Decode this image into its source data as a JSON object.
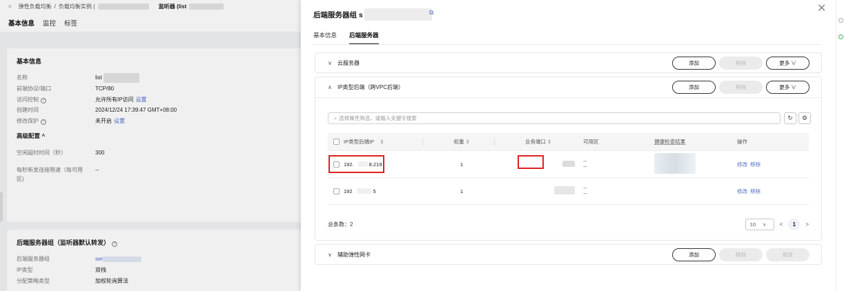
{
  "bg": {
    "breadcrumb": [
      "弹性负载均衡",
      "负载均衡实例 (",
      "监听器 (list"
    ],
    "tabs": [
      "基本信息",
      "监控",
      "标签"
    ],
    "card1": {
      "title": "基本信息",
      "rows": [
        {
          "k": "名称",
          "v": "list"
        },
        {
          "k": "前端协议/端口",
          "v": "TCP/80"
        },
        {
          "k": "访问控制",
          "v": "允许所有IP访问",
          "link": "设置"
        },
        {
          "k": "创建时间",
          "v": "2024/12/24 17:39:47 GMT+08:00"
        },
        {
          "k": "修改保护",
          "v": "未开启",
          "link": "设置"
        }
      ],
      "advanced": "高级配置 ^",
      "rows2": [
        {
          "k": "空闲超时时间（秒）",
          "v": "300"
        },
        {
          "k": "每秒新发连接限速（每可用",
          "v": "--"
        },
        {
          "k": "区)",
          "v": ""
        }
      ]
    },
    "card2": {
      "title": "后端服务器组（监听器默认转发）",
      "rows": [
        {
          "k": "后端服务器组",
          "v": "ser"
        },
        {
          "k": "IP类型",
          "v": "双栈"
        },
        {
          "k": "分配策略类型",
          "v": "加权轮询算法"
        }
      ]
    }
  },
  "drawer": {
    "title": "后端服务器组 s",
    "tabs": [
      "基本信息",
      "后端服务器"
    ],
    "sections": [
      {
        "title": "云服务器",
        "chev": "∨",
        "buttons": {
          "add": "添加",
          "remove": "移除",
          "more": "更多 ∨"
        }
      },
      {
        "title": "IP类型后端（跨VPC后端）",
        "chev": "∧",
        "buttons": {
          "add": "添加",
          "remove": "移除",
          "more": "更多 ∨"
        }
      },
      {
        "title": "辅助弹性网卡",
        "chev": "∨",
        "buttons": {
          "add": "添加",
          "remove": "移除",
          "edit": "修改"
        }
      }
    ],
    "search_placeholder": "选择属性筛选，或输入关键字搜索",
    "table": {
      "headers": [
        "IP类型后端IP",
        "权重",
        "业务端口",
        "可用区",
        "健康检查结果",
        "操作"
      ],
      "rows": [
        {
          "ip_a": "192.",
          "ip_b": "8.219",
          "weight": "1",
          "zone": "--",
          "actions": [
            "修改",
            "移除"
          ]
        },
        {
          "ip_a": "192",
          "ip_b": "5",
          "weight": "1",
          "zone": "--",
          "actions": [
            "修改",
            "移除"
          ]
        }
      ]
    },
    "total": "总条数：2",
    "pager": {
      "size": "10",
      "current": "1"
    }
  }
}
